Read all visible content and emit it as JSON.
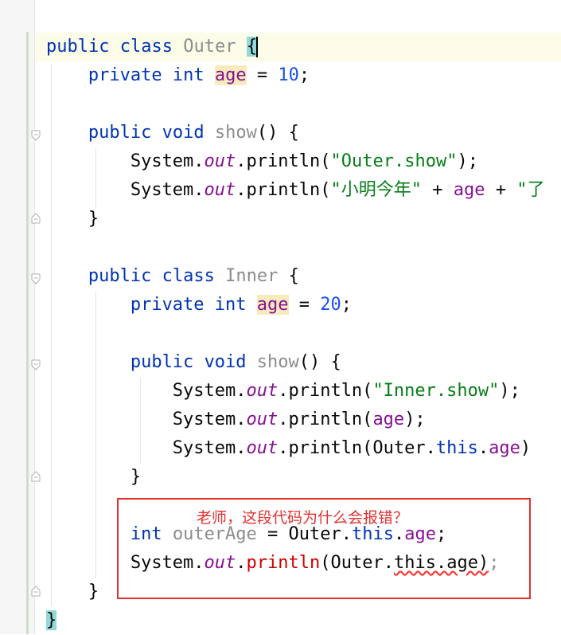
{
  "editor": {
    "lines": [
      {
        "tokens": [
          [
            "public",
            "kw"
          ],
          [
            " ",
            ""
          ],
          [
            "class",
            "kw"
          ],
          [
            " ",
            ""
          ],
          [
            "Outer",
            "cls-decl"
          ],
          [
            " ",
            ""
          ],
          [
            "{",
            "brace-hl"
          ]
        ]
      },
      {
        "tokens": [
          [
            "private",
            "kw"
          ],
          [
            " ",
            ""
          ],
          [
            "int",
            "kw"
          ],
          [
            " ",
            ""
          ],
          [
            "age",
            "fld-hl"
          ],
          [
            " = ",
            ""
          ],
          [
            "10",
            "num"
          ],
          [
            ";",
            ""
          ]
        ]
      },
      {
        "tokens": []
      },
      {
        "tokens": [
          [
            "public",
            "kw"
          ],
          [
            " ",
            ""
          ],
          [
            "void",
            "kw"
          ],
          [
            " ",
            ""
          ],
          [
            "show",
            "cls-decl"
          ],
          [
            "() {",
            ""
          ]
        ]
      },
      {
        "tokens": [
          [
            "System.",
            ""
          ],
          [
            "out",
            "static-f"
          ],
          [
            ".println(",
            ""
          ],
          [
            "\"Outer.show\"",
            "str"
          ],
          [
            ");",
            ""
          ]
        ]
      },
      {
        "tokens": [
          [
            "System.",
            ""
          ],
          [
            "out",
            "static-f"
          ],
          [
            ".println(",
            ""
          ],
          [
            "\"小明今年\"",
            "str"
          ],
          [
            " + ",
            ""
          ],
          [
            "age",
            "fld"
          ],
          [
            " + ",
            ""
          ],
          [
            "\"了",
            "str"
          ]
        ]
      },
      {
        "tokens": [
          [
            "}",
            ""
          ]
        ]
      },
      {
        "tokens": []
      },
      {
        "tokens": [
          [
            "public",
            "kw"
          ],
          [
            " ",
            ""
          ],
          [
            "class",
            "kw"
          ],
          [
            " ",
            ""
          ],
          [
            "Inner",
            "cls-decl"
          ],
          [
            " {",
            ""
          ]
        ]
      },
      {
        "tokens": [
          [
            "private",
            "kw"
          ],
          [
            " ",
            ""
          ],
          [
            "int",
            "kw"
          ],
          [
            " ",
            ""
          ],
          [
            "age",
            "fld-hl"
          ],
          [
            " = ",
            ""
          ],
          [
            "20",
            "num"
          ],
          [
            ";",
            ""
          ]
        ]
      },
      {
        "tokens": []
      },
      {
        "tokens": [
          [
            "public",
            "kw"
          ],
          [
            " ",
            ""
          ],
          [
            "void",
            "kw"
          ],
          [
            " ",
            ""
          ],
          [
            "show",
            "cls-decl"
          ],
          [
            "() {",
            ""
          ]
        ]
      },
      {
        "tokens": [
          [
            "System.",
            ""
          ],
          [
            "out",
            "static-f"
          ],
          [
            ".println(",
            ""
          ],
          [
            "\"Inner.show\"",
            "str"
          ],
          [
            ");",
            ""
          ]
        ]
      },
      {
        "tokens": [
          [
            "System.",
            ""
          ],
          [
            "out",
            "static-f"
          ],
          [
            ".println(",
            ""
          ],
          [
            "age",
            "fld"
          ],
          [
            ");",
            ""
          ]
        ]
      },
      {
        "tokens": [
          [
            "System.",
            ""
          ],
          [
            "out",
            "static-f"
          ],
          [
            ".println(Outer.",
            ""
          ],
          [
            "this",
            "kw"
          ],
          [
            ".",
            ""
          ],
          [
            "age",
            "fld"
          ],
          [
            ")",
            ""
          ]
        ]
      },
      {
        "tokens": [
          [
            "}",
            ""
          ]
        ]
      },
      {
        "tokens": []
      },
      {
        "tokens": [
          [
            "int",
            "kw"
          ],
          [
            " ",
            ""
          ],
          [
            "outerAge",
            "grey"
          ],
          [
            " = Outer.",
            ""
          ],
          [
            "this",
            "kw"
          ],
          [
            ".",
            ""
          ],
          [
            "age",
            "fld"
          ],
          [
            ";",
            ""
          ]
        ]
      },
      {
        "tokens": [
          [
            "System.",
            ""
          ],
          [
            "out",
            "static-f"
          ],
          [
            ".",
            ""
          ],
          [
            "println",
            "err"
          ],
          [
            "(Outer.",
            ""
          ],
          [
            "this.age)",
            "squiggle"
          ],
          [
            ";",
            "grey"
          ]
        ]
      },
      {
        "tokens": [
          [
            "}",
            ""
          ]
        ]
      },
      {
        "tokens": [
          [
            "}",
            "brace-hl"
          ]
        ]
      }
    ]
  },
  "annotation": {
    "text": "老师，这段代码为什么会报错？",
    "color": "#e03030"
  },
  "colors": {
    "keyword": "#0033b3",
    "field": "#871094",
    "string": "#067d17",
    "number": "#1750eb",
    "error": "#d00000"
  }
}
